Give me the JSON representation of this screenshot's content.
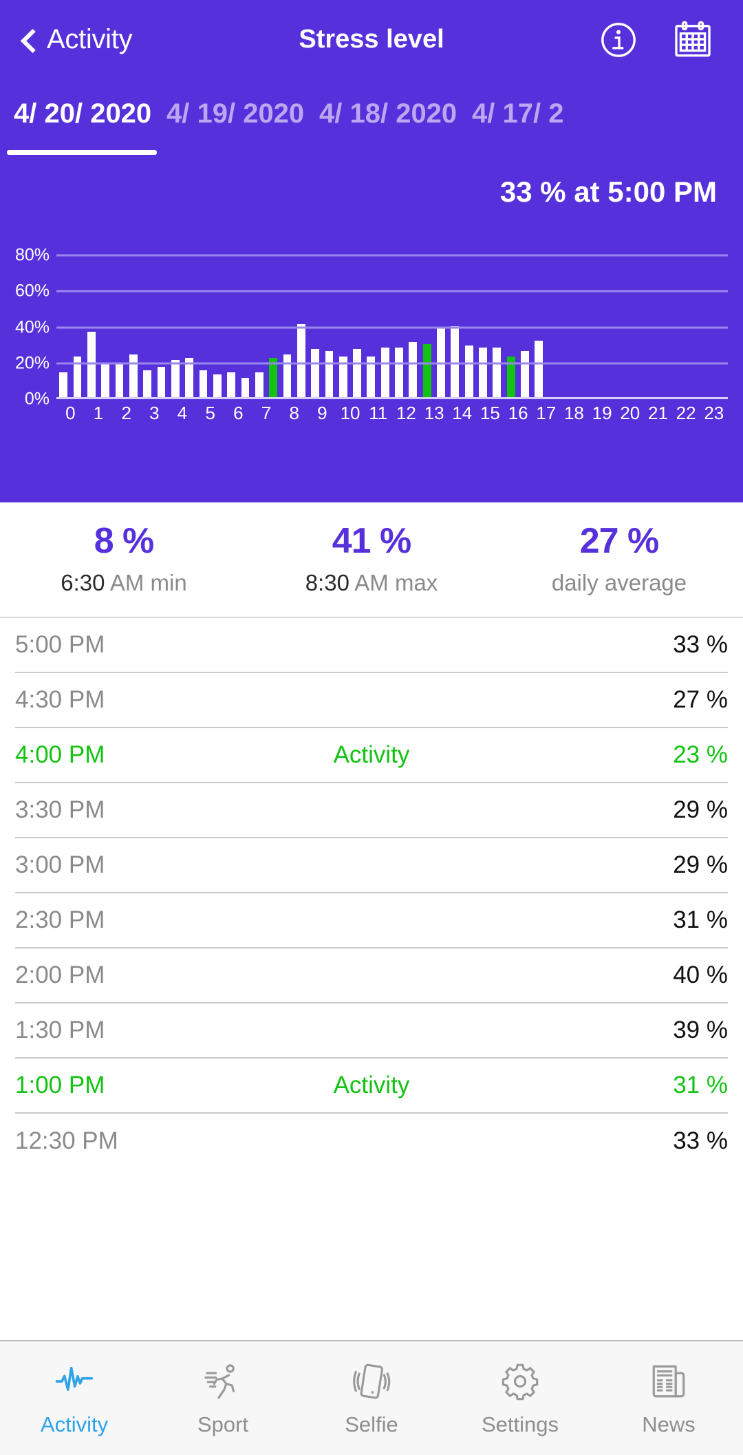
{
  "header": {
    "back_label": "Activity",
    "title": "Stress level",
    "info_icon": "info-circle-icon",
    "calendar_icon": "calendar-icon"
  },
  "date_tabs": [
    {
      "label": "4/ 20/ 2020",
      "active": true
    },
    {
      "label": "4/ 19/ 2020",
      "active": false
    },
    {
      "label": "4/ 18/ 2020",
      "active": false
    },
    {
      "label": "4/ 17/ 2",
      "active": false
    }
  ],
  "chart_readout": "33 % at 5:00 PM",
  "chart_data": {
    "type": "bar",
    "title": "33 % at 5:00 PM",
    "xlabel": "",
    "ylabel": "",
    "ylim": [
      0,
      90
    ],
    "grid": true,
    "ytick_labels": [
      "0%",
      "20%",
      "40%",
      "60%",
      "80%"
    ],
    "ytick_values": [
      0,
      20,
      40,
      60,
      80
    ],
    "categories": [
      "0",
      "1",
      "2",
      "3",
      "4",
      "5",
      "6",
      "7",
      "8",
      "9",
      "10",
      "11",
      "12",
      "13",
      "14",
      "15",
      "16",
      "17",
      "18",
      "19",
      "20",
      "21",
      "22",
      "23"
    ],
    "bar_color": "#FFFFFF",
    "activity_color": "#12C312",
    "background": "#5631DB",
    "half_hour_values": [
      {
        "hour": 0,
        "a": 14,
        "b": 23,
        "a_act": false,
        "b_act": false
      },
      {
        "hour": 1,
        "a": 37,
        "b": 19,
        "a_act": false,
        "b_act": false
      },
      {
        "hour": 2,
        "a": 19,
        "b": 24,
        "a_act": false,
        "b_act": false
      },
      {
        "hour": 3,
        "a": 15,
        "b": 17,
        "a_act": false,
        "b_act": false
      },
      {
        "hour": 4,
        "a": 21,
        "b": 22,
        "a_act": false,
        "b_act": false
      },
      {
        "hour": 5,
        "a": 15,
        "b": 13,
        "a_act": false,
        "b_act": false
      },
      {
        "hour": 6,
        "a": 14,
        "b": 11,
        "a_act": false,
        "b_act": false
      },
      {
        "hour": 7,
        "a": 14,
        "b": 22,
        "a_act": false,
        "b_act": true
      },
      {
        "hour": 8,
        "a": 24,
        "b": 41,
        "a_act": false,
        "b_act": false
      },
      {
        "hour": 9,
        "a": 27,
        "b": 26,
        "a_act": false,
        "b_act": false
      },
      {
        "hour": 10,
        "a": 23,
        "b": 27,
        "a_act": false,
        "b_act": false
      },
      {
        "hour": 11,
        "a": 23,
        "b": 28,
        "a_act": false,
        "b_act": false
      },
      {
        "hour": 12,
        "a": 28,
        "b": 31,
        "a_act": false,
        "b_act": false
      },
      {
        "hour": 13,
        "a": 30,
        "b": 39,
        "a_act": true,
        "b_act": false
      },
      {
        "hour": 14,
        "a": 40,
        "b": 29,
        "a_act": false,
        "b_act": false
      },
      {
        "hour": 15,
        "a": 28,
        "b": 28,
        "a_act": false,
        "b_act": false
      },
      {
        "hour": 16,
        "a": 23,
        "b": 26,
        "a_act": true,
        "b_act": false
      },
      {
        "hour": 17,
        "a": 32,
        "b": 0,
        "a_act": false,
        "b_act": false
      },
      {
        "hour": 18,
        "a": 0,
        "b": 0,
        "a_act": false,
        "b_act": false
      },
      {
        "hour": 19,
        "a": 0,
        "b": 0,
        "a_act": false,
        "b_act": false
      },
      {
        "hour": 20,
        "a": 0,
        "b": 0,
        "a_act": false,
        "b_act": false
      },
      {
        "hour": 21,
        "a": 0,
        "b": 0,
        "a_act": false,
        "b_act": false
      },
      {
        "hour": 22,
        "a": 0,
        "b": 0,
        "a_act": false,
        "b_act": false
      },
      {
        "hour": 23,
        "a": 0,
        "b": 0,
        "a_act": false,
        "b_act": false
      }
    ]
  },
  "stats": [
    {
      "value": "8 %",
      "time": "6:30 ",
      "suffix": "AM min"
    },
    {
      "value": "41 %",
      "time": "8:30 ",
      "suffix": "AM max"
    },
    {
      "value": "27 %",
      "time": "",
      "suffix": "daily average"
    }
  ],
  "rows": [
    {
      "time": "5:00 PM",
      "mid": "",
      "value": "33 %",
      "activity": false
    },
    {
      "time": "4:30 PM",
      "mid": "",
      "value": "27 %",
      "activity": false
    },
    {
      "time": "4:00 PM",
      "mid": "Activity",
      "value": "23 %",
      "activity": true
    },
    {
      "time": "3:30 PM",
      "mid": "",
      "value": "29 %",
      "activity": false
    },
    {
      "time": "3:00 PM",
      "mid": "",
      "value": "29 %",
      "activity": false
    },
    {
      "time": "2:30 PM",
      "mid": "",
      "value": "31 %",
      "activity": false
    },
    {
      "time": "2:00 PM",
      "mid": "",
      "value": "40 %",
      "activity": false
    },
    {
      "time": "1:30 PM",
      "mid": "",
      "value": "39 %",
      "activity": false
    },
    {
      "time": "1:00 PM",
      "mid": "Activity",
      "value": "31 %",
      "activity": true
    },
    {
      "time": "12:30 PM",
      "mid": "",
      "value": "33 %",
      "activity": false
    }
  ],
  "tabbar": [
    {
      "label": "Activity",
      "icon": "pulse-icon",
      "active": true
    },
    {
      "label": "Sport",
      "icon": "runner-icon",
      "active": false
    },
    {
      "label": "Selfie",
      "icon": "phone-icon",
      "active": false
    },
    {
      "label": "Settings",
      "icon": "gear-icon",
      "active": false
    },
    {
      "label": "News",
      "icon": "newspaper-icon",
      "active": false
    }
  ],
  "colors": {
    "brand_purple": "#5631DB",
    "activity_green": "#12C312",
    "accent_blue": "#2FA3E8"
  }
}
